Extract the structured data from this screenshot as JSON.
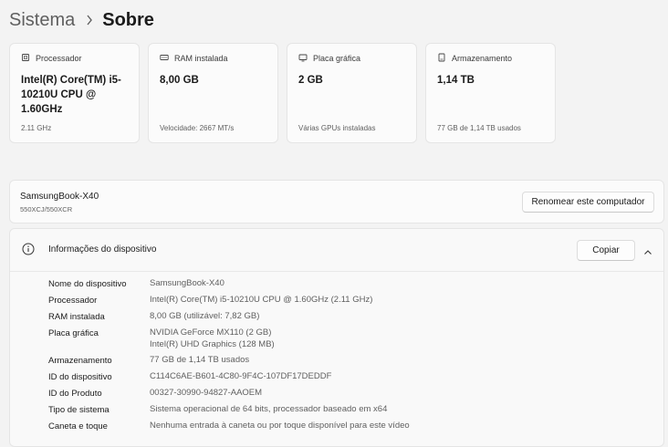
{
  "breadcrumb": {
    "parent": "Sistema",
    "current": "Sobre"
  },
  "cards": [
    {
      "icon": "processor-icon",
      "label": "Processador",
      "value": "Intel(R) Core(TM) i5-10210U CPU @ 1.60GHz",
      "sub": "2.11 GHz"
    },
    {
      "icon": "ram-icon",
      "label": "RAM instalada",
      "value": "8,00 GB",
      "sub": "Velocidade: 2667 MT/s"
    },
    {
      "icon": "gpu-icon",
      "label": "Placa gráfica",
      "value": "2 GB",
      "sub": "Várias GPUs instaladas"
    },
    {
      "icon": "storage-icon",
      "label": "Armazenamento",
      "value": "1,14 TB",
      "sub": "77 GB de 1,14 TB usados"
    }
  ],
  "device": {
    "name": "SamsungBook-X40",
    "model": "550XCJ/550XCR",
    "rename_label": "Renomear este computador"
  },
  "info": {
    "title": "Informações do dispositivo",
    "copy_label": "Copiar",
    "rows": [
      {
        "label": "Nome do dispositivo",
        "values": [
          "SamsungBook-X40"
        ]
      },
      {
        "label": "Processador",
        "values": [
          "Intel(R) Core(TM) i5-10210U CPU @ 1.60GHz (2.11 GHz)"
        ]
      },
      {
        "label": "RAM instalada",
        "values": [
          "8,00 GB (utilizável: 7,82 GB)"
        ]
      },
      {
        "label": "Placa gráfica",
        "values": [
          "NVIDIA GeForce MX110 (2 GB)",
          "Intel(R) UHD Graphics (128 MB)"
        ]
      },
      {
        "label": "Armazenamento",
        "values": [
          "77 GB de 1,14 TB usados"
        ]
      },
      {
        "label": "ID do dispositivo",
        "values": [
          "C114C6AE-B601-4C80-9F4C-107DF17DEDDF"
        ]
      },
      {
        "label": "ID do Produto",
        "values": [
          "00327-30990-94827-AAOEM"
        ]
      },
      {
        "label": "Tipo de sistema",
        "values": [
          "Sistema operacional de 64 bits, processador baseado em x64"
        ]
      },
      {
        "label": "Caneta e toque",
        "values": [
          "Nenhuma entrada à caneta ou por toque disponível para este vídeo"
        ]
      }
    ]
  }
}
